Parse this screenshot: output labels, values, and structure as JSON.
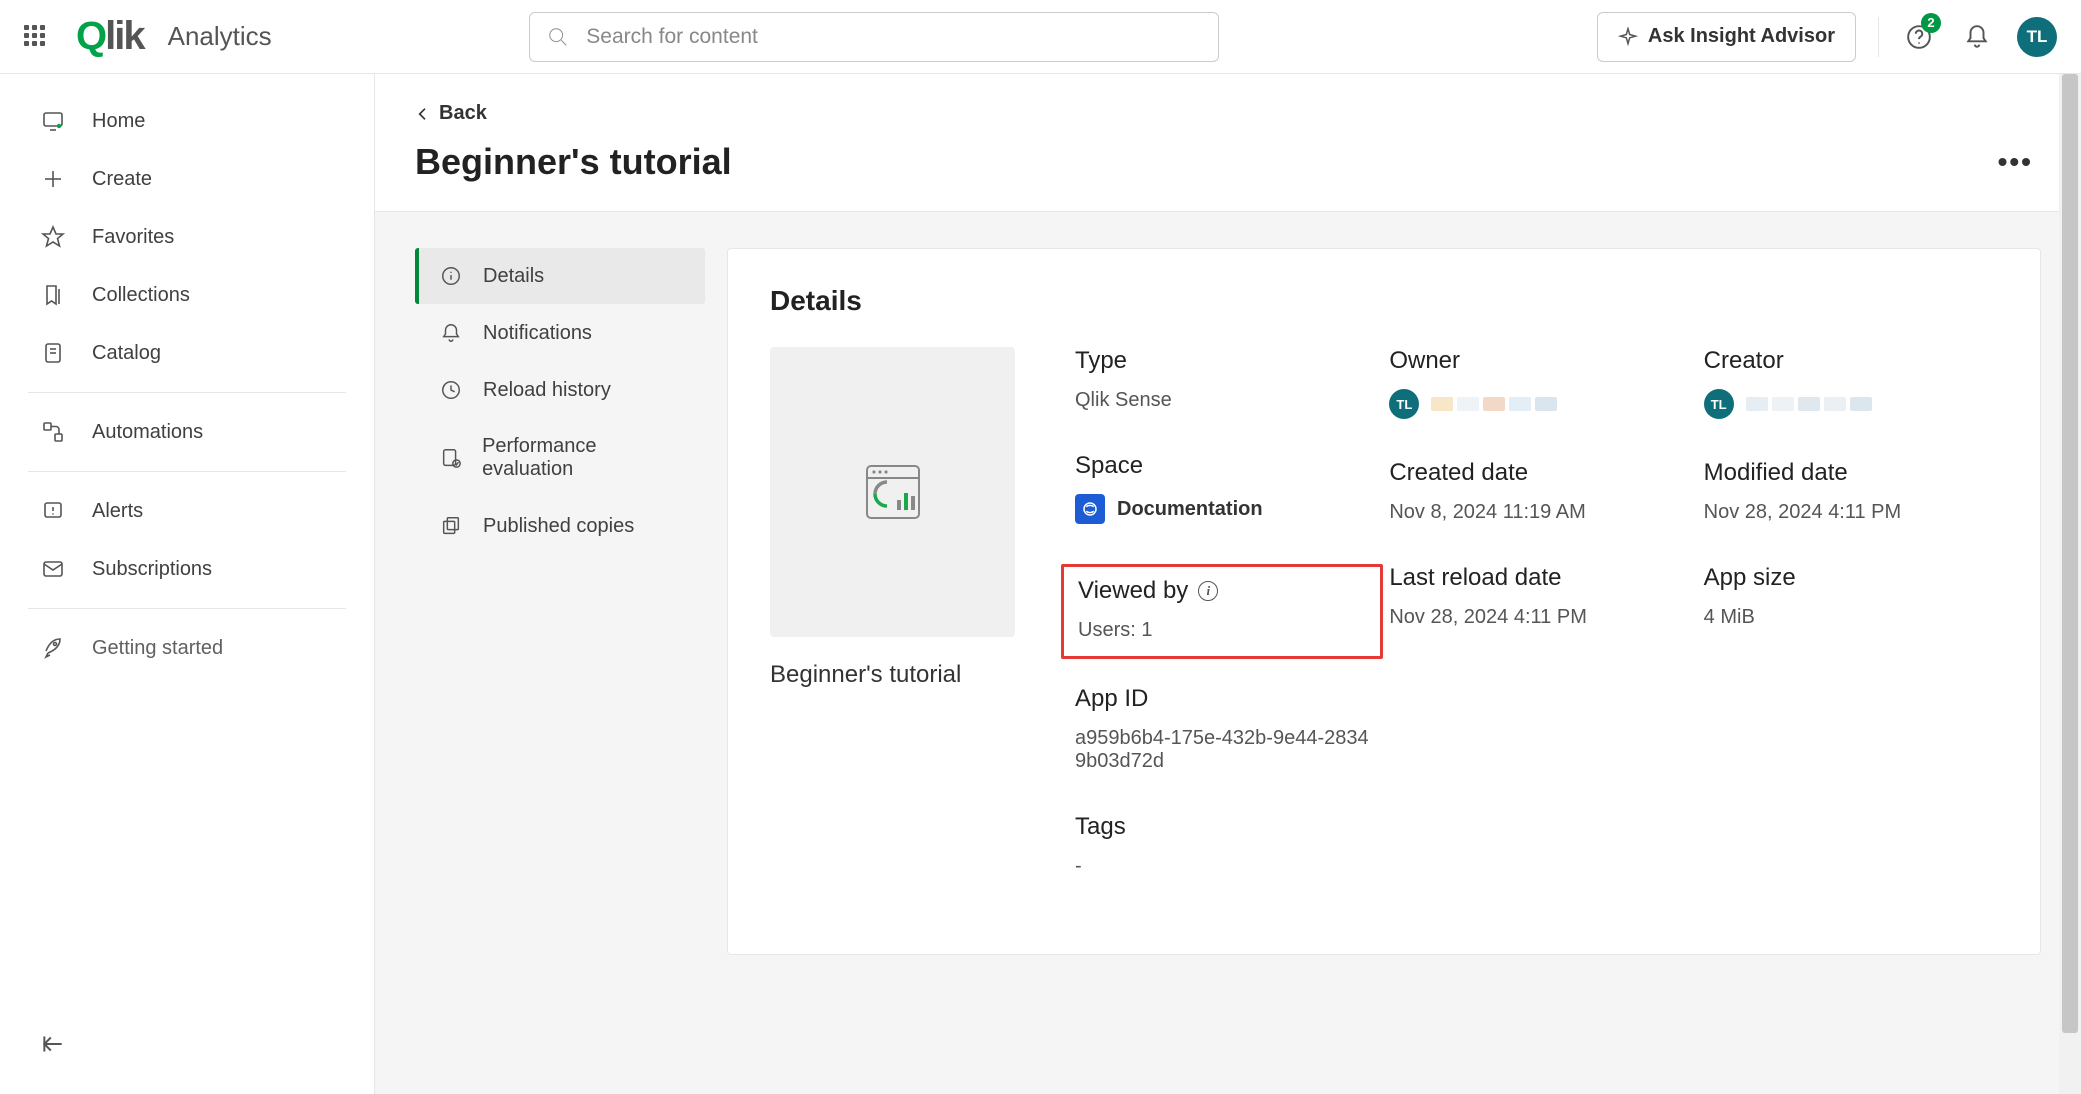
{
  "topbar": {
    "brand_sub": "Analytics",
    "search_placeholder": "Search for content",
    "ask_label": "Ask Insight Advisor",
    "notif_badge": "2",
    "avatar_initials": "TL"
  },
  "sidebar": {
    "items": [
      {
        "label": "Home",
        "icon": "monitor-icon"
      },
      {
        "label": "Create",
        "icon": "plus-icon"
      },
      {
        "label": "Favorites",
        "icon": "star-icon"
      },
      {
        "label": "Collections",
        "icon": "bookmark-icon"
      },
      {
        "label": "Catalog",
        "icon": "file-icon"
      },
      {
        "label": "Automations",
        "icon": "flow-icon"
      },
      {
        "label": "Alerts",
        "icon": "alert-icon"
      },
      {
        "label": "Subscriptions",
        "icon": "mail-icon"
      },
      {
        "label": "Getting started",
        "icon": "rocket-icon"
      }
    ]
  },
  "page": {
    "back_label": "Back",
    "title": "Beginner's tutorial"
  },
  "tabs": {
    "items": [
      {
        "label": "Details",
        "icon": "info-icon",
        "active": true
      },
      {
        "label": "Notifications",
        "icon": "bell-icon",
        "active": false
      },
      {
        "label": "Reload history",
        "icon": "history-icon",
        "active": false
      },
      {
        "label": "Performance evaluation",
        "icon": "perf-icon",
        "active": false
      },
      {
        "label": "Published copies",
        "icon": "copies-icon",
        "active": false
      }
    ]
  },
  "details": {
    "card_title": "Details",
    "thumb_title": "Beginner's tutorial",
    "type_label": "Type",
    "type_value": "Qlik Sense",
    "space_label": "Space",
    "space_value": "Documentation",
    "viewed_label": "Viewed by",
    "viewed_value": "Users: 1",
    "appid_label": "App ID",
    "appid_value": "a959b6b4-175e-432b-9e44-28349b03d72d",
    "tags_label": "Tags",
    "tags_value": "-",
    "owner_label": "Owner",
    "owner_initials": "TL",
    "creator_label": "Creator",
    "creator_initials": "TL",
    "created_label": "Created date",
    "created_value": "Nov 8, 2024 11:19 AM",
    "modified_label": "Modified date",
    "modified_value": "Nov 28, 2024 4:11 PM",
    "lastreload_label": "Last reload date",
    "lastreload_value": "Nov 28, 2024 4:11 PM",
    "appsize_label": "App size",
    "appsize_value": "4 MiB"
  }
}
